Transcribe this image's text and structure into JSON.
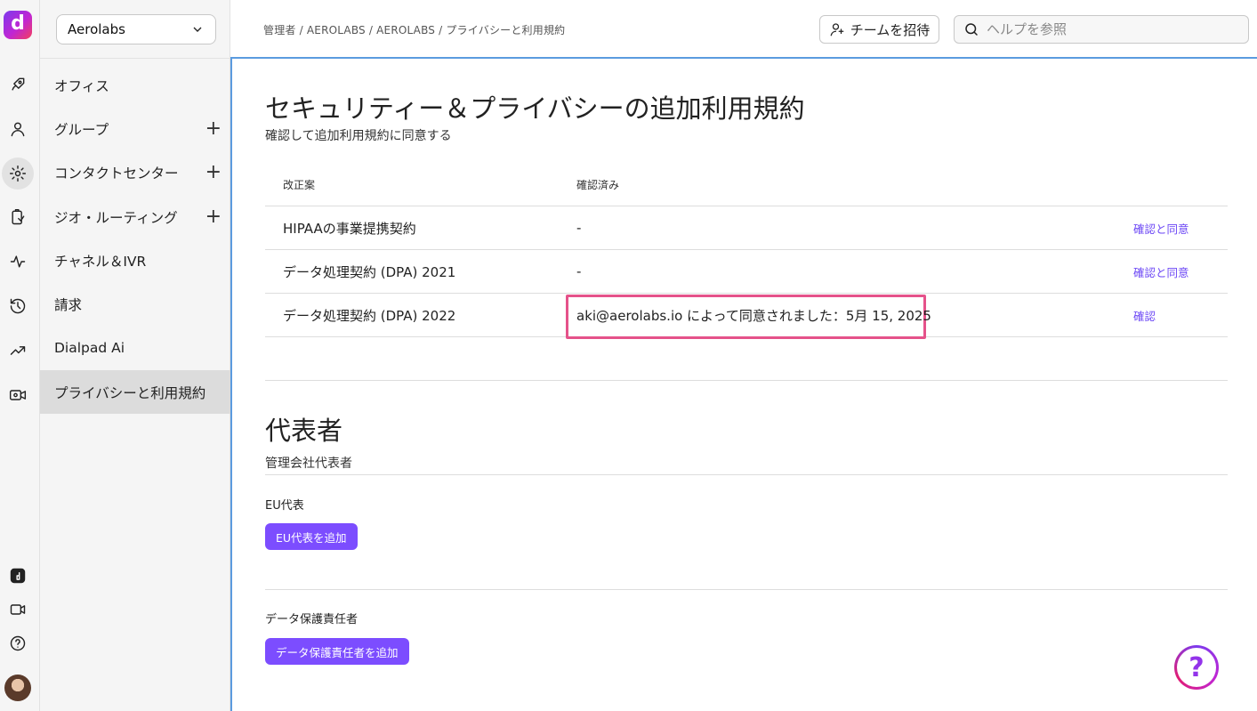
{
  "app": {
    "logo_glyph": "d"
  },
  "org_select": {
    "value": "Aerolabs"
  },
  "sidebar": {
    "items": [
      {
        "label": "オフィス",
        "expandable": false
      },
      {
        "label": "グループ",
        "expandable": true
      },
      {
        "label": "コンタクトセンター",
        "expandable": true
      },
      {
        "label": "ジオ・ルーティング",
        "expandable": true
      },
      {
        "label": "チャネル＆IVR",
        "expandable": false
      },
      {
        "label": "請求",
        "expandable": false
      },
      {
        "label": "Dialpad Ai",
        "expandable": false
      },
      {
        "label": "プライバシーと利用規約",
        "expandable": false,
        "active": true
      }
    ],
    "plus_glyph": "+"
  },
  "breadcrumb": "管理者 / AEROLABS / AEROLABS / プライバシーと利用規約",
  "header": {
    "invite_label": "チームを招待",
    "help_search_placeholder": "ヘルプを参照"
  },
  "terms": {
    "title": "セキュリティー＆プライバシーの追加利用規約",
    "subtitle": "確認して追加利用規約に同意する",
    "columns": [
      "改正案",
      "確認済み"
    ],
    "rows": [
      {
        "name": "HIPAAの事業提携契約",
        "status": "-",
        "action": "確認と同意"
      },
      {
        "name": "データ処理契約 (DPA) 2021",
        "status": "-",
        "action": "確認と同意"
      },
      {
        "name": "データ処理契約 (DPA) 2022",
        "status": "aki@aerolabs.io によって同意されました：5月 15, 2025",
        "action": "確認"
      }
    ]
  },
  "representatives": {
    "title": "代表者",
    "subtitle": "管理会社代表者",
    "eu_label": "EU代表",
    "eu_button": "EU代表を追加",
    "dpo_label": "データ保護責任者",
    "dpo_button": "データ保護責任者を追加"
  },
  "help_fab": {
    "glyph": "?"
  },
  "colors": {
    "accent": "#7c4dff",
    "link": "#6b46f5",
    "highlight": "#e5528a",
    "panel_border": "#5b9bdf"
  }
}
